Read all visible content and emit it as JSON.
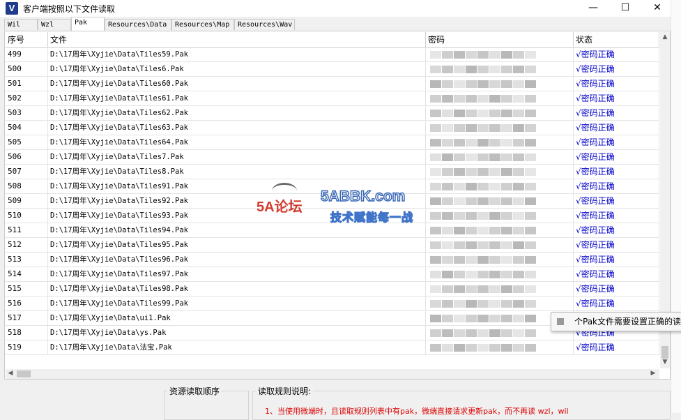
{
  "window": {
    "app_icon": "V",
    "title": "客户端按照以下文件读取",
    "minimize": "—",
    "maximize": "☐",
    "close": "✕"
  },
  "tabs": [
    {
      "label": "Wil"
    },
    {
      "label": "Wzl"
    },
    {
      "label": "Pak"
    },
    {
      "label": "Resources\\Data"
    },
    {
      "label": "Resources\\Map"
    },
    {
      "label": "Resources\\Wav"
    }
  ],
  "active_tab": "Pak",
  "table": {
    "headers": {
      "num": "序号",
      "file": "文件",
      "password": "密码",
      "status": "状态"
    },
    "rows": [
      {
        "num": "499",
        "file": "D:\\17周年\\Xyjie\\Data\\Tiles59.Pak",
        "status": "√密码正确"
      },
      {
        "num": "500",
        "file": "D:\\17周年\\Xyjie\\Data\\Tiles6.Pak",
        "status": "√密码正确"
      },
      {
        "num": "501",
        "file": "D:\\17周年\\Xyjie\\Data\\Tiles60.Pak",
        "status": "√密码正确"
      },
      {
        "num": "502",
        "file": "D:\\17周年\\Xyjie\\Data\\Tiles61.Pak",
        "status": "√密码正确"
      },
      {
        "num": "503",
        "file": "D:\\17周年\\Xyjie\\Data\\Tiles62.Pak",
        "status": "√密码正确"
      },
      {
        "num": "504",
        "file": "D:\\17周年\\Xyjie\\Data\\Tiles63.Pak",
        "status": "√密码正确"
      },
      {
        "num": "505",
        "file": "D:\\17周年\\Xyjie\\Data\\Tiles64.Pak",
        "status": "√密码正确"
      },
      {
        "num": "506",
        "file": "D:\\17周年\\Xyjie\\Data\\Tiles7.Pak",
        "status": "√密码正确"
      },
      {
        "num": "507",
        "file": "D:\\17周年\\Xyjie\\Data\\Tiles8.Pak",
        "status": "√密码正确"
      },
      {
        "num": "508",
        "file": "D:\\17周年\\Xyjie\\Data\\Tiles91.Pak",
        "status": "√密码正确"
      },
      {
        "num": "509",
        "file": "D:\\17周年\\Xyjie\\Data\\Tiles92.Pak",
        "status": "√密码正确"
      },
      {
        "num": "510",
        "file": "D:\\17周年\\Xyjie\\Data\\Tiles93.Pak",
        "status": "√密码正确"
      },
      {
        "num": "511",
        "file": "D:\\17周年\\Xyjie\\Data\\Tiles94.Pak",
        "status": "√密码正确"
      },
      {
        "num": "512",
        "file": "D:\\17周年\\Xyjie\\Data\\Tiles95.Pak",
        "status": "√密码正确"
      },
      {
        "num": "513",
        "file": "D:\\17周年\\Xyjie\\Data\\Tiles96.Pak",
        "status": "√密码正确"
      },
      {
        "num": "514",
        "file": "D:\\17周年\\Xyjie\\Data\\Tiles97.Pak",
        "status": "√密码正确"
      },
      {
        "num": "515",
        "file": "D:\\17周年\\Xyjie\\Data\\Tiles98.Pak",
        "status": "√密码正确"
      },
      {
        "num": "516",
        "file": "D:\\17周年\\Xyjie\\Data\\Tiles99.Pak",
        "status": "√密码正确"
      },
      {
        "num": "517",
        "file": "D:\\17周年\\Xyjie\\Data\\ui1.Pak",
        "status": ""
      },
      {
        "num": "518",
        "file": "D:\\17周年\\Xyjie\\Data\\ys.Pak",
        "status": "√密码正确"
      },
      {
        "num": "519",
        "file": "D:\\17周年\\Xyjie\\Data\\法宝.Pak",
        "status": "√密码正确"
      }
    ]
  },
  "tooltip": {
    "text": "个Pak文件需要设置正确的读取"
  },
  "bottom": {
    "group1_label": "资源读取顺序",
    "group2_label": "读取规则说明:",
    "rule_1": "1、当使用微端时，且读取规则列表中有pak，微端直接请求更新pak，而不再读 wzl，wil"
  },
  "watermark": {
    "logo": "5A论坛",
    "site": "5ABBK.com",
    "slogan": "技术赋能每一战"
  },
  "icons": {
    "scroll_up": "▲",
    "scroll_down": "▼",
    "scroll_left": "◀",
    "scroll_right": "▶"
  }
}
